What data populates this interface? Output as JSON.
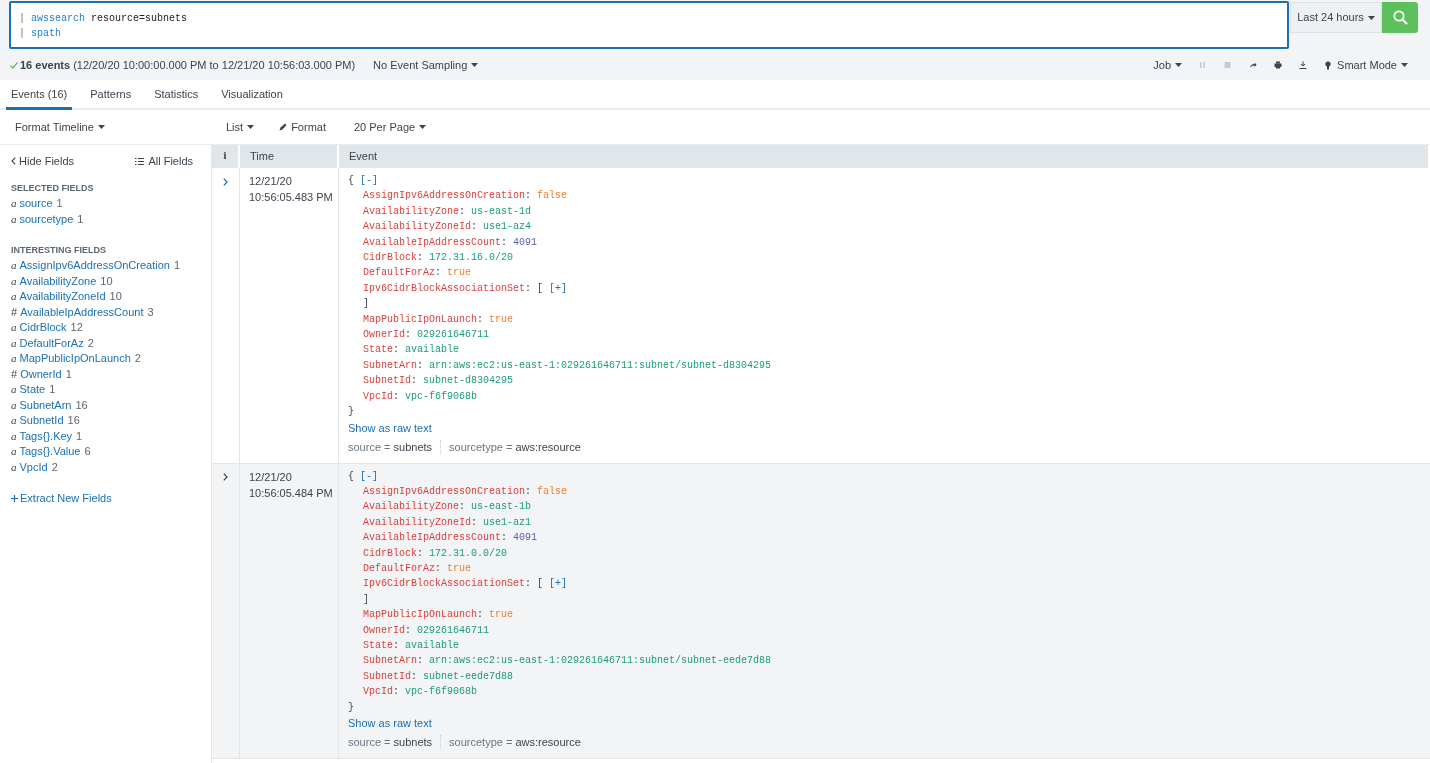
{
  "search": {
    "query": [
      {
        "pipe": "|",
        "command": "awssearch",
        "args": "resource=subnets"
      },
      {
        "pipe": "|",
        "command": "spath"
      }
    ],
    "time_range": "Last 24 hours"
  },
  "status": {
    "count": "16 events",
    "range": "(12/20/20 10:00:00.000 PM to 12/21/20 10:56:03.000 PM)",
    "sampling": "No Event Sampling",
    "job": "Job",
    "mode": "Smart Mode"
  },
  "tabs": [
    {
      "label": "Events (16)",
      "selected": true
    },
    {
      "label": "Patterns",
      "selected": false
    },
    {
      "label": "Statistics",
      "selected": false
    },
    {
      "label": "Visualization",
      "selected": false
    }
  ],
  "toolbar": {
    "timeline": "Format Timeline",
    "list": "List",
    "format": "Format",
    "per_page": "20 Per Page"
  },
  "sidebar": {
    "hide": "Hide Fields",
    "all": "All Fields",
    "sections": [
      {
        "title": "SELECTED FIELDS",
        "fields": [
          {
            "type": "a",
            "name": "source",
            "count": "1"
          },
          {
            "type": "a",
            "name": "sourcetype",
            "count": "1"
          }
        ]
      },
      {
        "title": "INTERESTING FIELDS",
        "fields": [
          {
            "type": "a",
            "name": "AssignIpv6AddressOnCreation",
            "count": "1"
          },
          {
            "type": "a",
            "name": "AvailabilityZone",
            "count": "10"
          },
          {
            "type": "a",
            "name": "AvailabilityZoneId",
            "count": "10"
          },
          {
            "type": "#",
            "name": "AvailableIpAddressCount",
            "count": "3"
          },
          {
            "type": "a",
            "name": "CidrBlock",
            "count": "12"
          },
          {
            "type": "a",
            "name": "DefaultForAz",
            "count": "2"
          },
          {
            "type": "a",
            "name": "MapPublicIpOnLaunch",
            "count": "2"
          },
          {
            "type": "#",
            "name": "OwnerId",
            "count": "1"
          },
          {
            "type": "a",
            "name": "State",
            "count": "1"
          },
          {
            "type": "a",
            "name": "SubnetArn",
            "count": "16"
          },
          {
            "type": "a",
            "name": "SubnetId",
            "count": "16"
          },
          {
            "type": "a",
            "name": "Tags{}.Key",
            "count": "1"
          },
          {
            "type": "a",
            "name": "Tags{}.Value",
            "count": "6"
          },
          {
            "type": "a",
            "name": "VpcId",
            "count": "2"
          }
        ]
      }
    ],
    "extract": "Extract New Fields"
  },
  "table": {
    "columns": [
      "i",
      "Time",
      "Event"
    ],
    "events": [
      {
        "highlighted": false,
        "date": "12/21/20",
        "time": "10:56:05.483 PM",
        "open": "{",
        "collapse": "[-]",
        "close": "}",
        "raw_link": "Show as raw text",
        "fields": [
          {
            "key": "AssignIpv6AddressOnCreation",
            "sep": ":",
            "kind": "bool",
            "value": "false"
          },
          {
            "key": "AvailabilityZone",
            "sep": ":",
            "kind": "string",
            "value": "us-east-1d"
          },
          {
            "key": "AvailabilityZoneId",
            "sep": ":",
            "kind": "string",
            "value": "use1-az4"
          },
          {
            "key": "AvailableIpAddressCount",
            "sep": ":",
            "kind": "number",
            "value": "4091"
          },
          {
            "key": "CidrBlock",
            "sep": ":",
            "kind": "string",
            "value": "172.31.16.0/20"
          },
          {
            "key": "DefaultForAz",
            "sep": ":",
            "kind": "bool",
            "value": "true"
          },
          {
            "key": "Ipv6CidrBlockAssociationSet",
            "sep": ":",
            "kind": "array",
            "open": "[",
            "expander": "[+]",
            "close": "]"
          },
          {
            "key": "MapPublicIpOnLaunch",
            "sep": ":",
            "kind": "bool",
            "value": "true"
          },
          {
            "key": "OwnerId",
            "sep": ":",
            "kind": "string",
            "value": "029261646711"
          },
          {
            "key": "State",
            "sep": ":",
            "kind": "string",
            "value": "available"
          },
          {
            "key": "SubnetArn",
            "sep": ":",
            "kind": "string",
            "value": "arn:aws:ec2:us-east-1:029261646711:subnet/subnet-d8304295"
          },
          {
            "key": "SubnetId",
            "sep": ":",
            "kind": "string",
            "value": "subnet-d8304295"
          },
          {
            "key": "VpcId",
            "sep": ":",
            "kind": "string",
            "value": "vpc-f6f9068b"
          }
        ],
        "meta": [
          {
            "label": "source =",
            "value": "subnets"
          },
          {
            "label": "sourcetype =",
            "value": "aws:resource"
          }
        ]
      },
      {
        "highlighted": true,
        "date": "12/21/20",
        "time": "10:56:05.484 PM",
        "open": "{",
        "collapse": "[-]",
        "close": "}",
        "raw_link": "Show as raw text",
        "fields": [
          {
            "key": "AssignIpv6AddressOnCreation",
            "sep": ":",
            "kind": "bool",
            "value": "false"
          },
          {
            "key": "AvailabilityZone",
            "sep": ":",
            "kind": "string",
            "value": "us-east-1b"
          },
          {
            "key": "AvailabilityZoneId",
            "sep": ":",
            "kind": "string",
            "value": "use1-az1"
          },
          {
            "key": "AvailableIpAddressCount",
            "sep": ":",
            "kind": "number",
            "value": "4091"
          },
          {
            "key": "CidrBlock",
            "sep": ":",
            "kind": "string",
            "value": "172.31.0.0/20"
          },
          {
            "key": "DefaultForAz",
            "sep": ":",
            "kind": "bool",
            "value": "true"
          },
          {
            "key": "Ipv6CidrBlockAssociationSet",
            "sep": ":",
            "kind": "array",
            "open": "[",
            "expander": "[+]",
            "close": "]"
          },
          {
            "key": "MapPublicIpOnLaunch",
            "sep": ":",
            "kind": "bool",
            "value": "true"
          },
          {
            "key": "OwnerId",
            "sep": ":",
            "kind": "string",
            "value": "029261646711"
          },
          {
            "key": "State",
            "sep": ":",
            "kind": "string",
            "value": "available"
          },
          {
            "key": "SubnetArn",
            "sep": ":",
            "kind": "string",
            "value": "arn:aws:ec2:us-east-1:029261646711:subnet/subnet-eede7d88"
          },
          {
            "key": "SubnetId",
            "sep": ":",
            "kind": "string",
            "value": "subnet-eede7d88"
          },
          {
            "key": "VpcId",
            "sep": ":",
            "kind": "string",
            "value": "vpc-f6f9068b"
          }
        ],
        "meta": [
          {
            "label": "source =",
            "value": "subnets"
          },
          {
            "label": "sourcetype =",
            "value": "aws:resource"
          }
        ]
      }
    ]
  }
}
